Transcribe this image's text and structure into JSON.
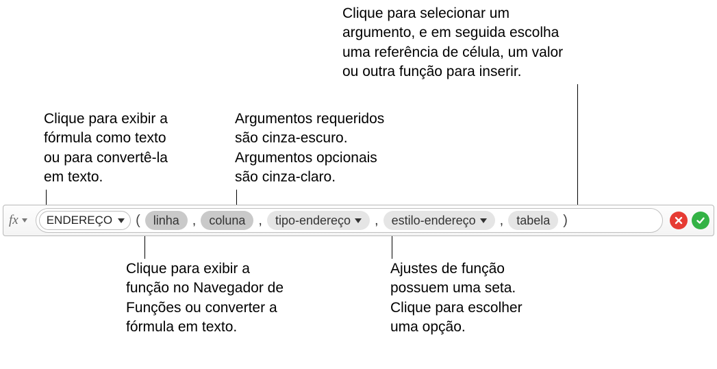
{
  "callouts": {
    "top_right": "Clique para selecionar um\nargumento, e em seguida escolha\numa referência de célula, um valor\nou outra função para inserir.",
    "top_left": "Clique para exibir a\nfórmula como texto\nou para convertê-la\nem texto.",
    "top_center": "Argumentos requeridos\nsão cinza-escuro.\nArgumentos opcionais\nsão cinza-claro.",
    "bottom_left": "Clique para exibir a\nfunção no Navegador de\nFunções ou converter a\nfórmula em texto.",
    "bottom_right": "Ajustes de função\npossuem uma seta.\nClique para escolher\numa opção."
  },
  "formula": {
    "fx_label": "fx",
    "function_name": "ENDEREÇO",
    "args": {
      "linha": "linha",
      "coluna": "coluna",
      "tipo_endereco": "tipo-endereço",
      "estilo_endereco": "estilo-endereço",
      "tabela": "tabela"
    }
  }
}
